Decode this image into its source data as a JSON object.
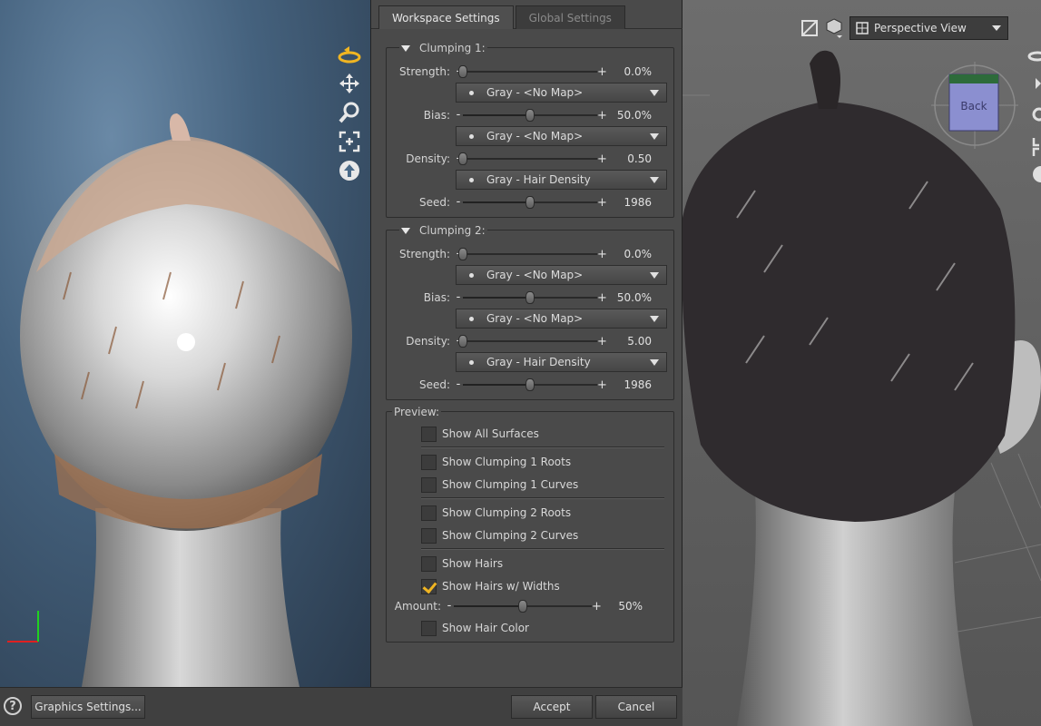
{
  "tabs": {
    "workspace": "Workspace Settings",
    "global": "Global Settings"
  },
  "clumping1": {
    "title": "Clumping 1:",
    "strength": {
      "label": "Strength:",
      "value": "0.0%",
      "fraction": 0.0,
      "map": "Gray - <No Map>"
    },
    "bias": {
      "label": "Bias:",
      "value": "50.0%",
      "fraction": 0.5,
      "map": "Gray - <No Map>"
    },
    "density": {
      "label": "Density:",
      "value": "0.50",
      "fraction": 0.0,
      "map": "Gray - Hair Density"
    },
    "seed": {
      "label": "Seed:",
      "value": "1986",
      "fraction": 0.5
    }
  },
  "clumping2": {
    "title": "Clumping 2:",
    "strength": {
      "label": "Strength:",
      "value": "0.0%",
      "fraction": 0.0,
      "map": "Gray - <No Map>"
    },
    "bias": {
      "label": "Bias:",
      "value": "50.0%",
      "fraction": 0.5,
      "map": "Gray - <No Map>"
    },
    "density": {
      "label": "Density:",
      "value": "5.00",
      "fraction": 0.0,
      "map": "Gray - Hair Density"
    },
    "seed": {
      "label": "Seed:",
      "value": "1986",
      "fraction": 0.5
    }
  },
  "preview": {
    "title": "Preview:",
    "show_all_surfaces": "Show All Surfaces",
    "show_clumping1_roots": "Show Clumping 1 Roots",
    "show_clumping1_curves": "Show Clumping 1 Curves",
    "show_clumping2_roots": "Show Clumping 2 Roots",
    "show_clumping2_curves": "Show Clumping 2 Curves",
    "show_hairs": "Show Hairs",
    "show_hairs_widths": "Show Hairs w/ Widths",
    "show_hairs_widths_checked": true,
    "amount": {
      "label": "Amount:",
      "value": "50%",
      "fraction": 0.5
    },
    "show_hair_color": "Show Hair Color"
  },
  "footer": {
    "help": "?",
    "graphics_settings": "Graphics Settings...",
    "accept": "Accept",
    "cancel": "Cancel"
  },
  "viewport_right": {
    "view_label": "Perspective View",
    "cube_label": "Back"
  },
  "colors": {
    "accent_check": "#f0b522"
  }
}
